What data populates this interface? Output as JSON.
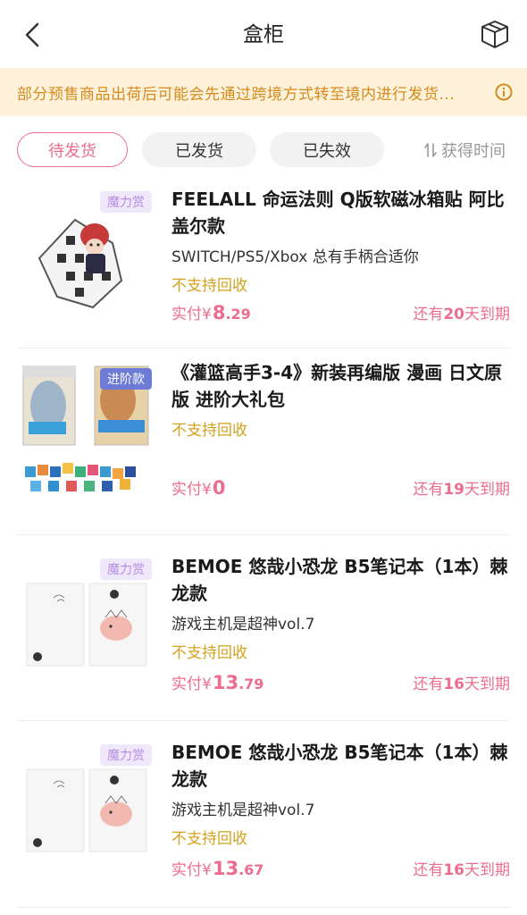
{
  "header": {
    "title": "盒柜",
    "back_icon": "chevron-left-icon",
    "box_icon": "box-icon"
  },
  "notice": {
    "text": "部分预售商品出荷后可能会先通过跨境方式转至境内进行发货...",
    "icon": "info-icon",
    "bg_color": "#fdf1d9",
    "text_color": "#d58b1e"
  },
  "tabs": [
    {
      "label": "待发货",
      "active": true
    },
    {
      "label": "已发货",
      "active": false
    },
    {
      "label": "已失效",
      "active": false
    }
  ],
  "sort": {
    "label": "获得时间",
    "icon": "sort-icon"
  },
  "accent_color": "#ec6d8d",
  "items": [
    {
      "badge": "魔力赏",
      "name": "FEELALL 命运法则 Q版软磁冰箱贴 阿比盖尔款",
      "subtitle": "SWITCH/PS5/Xbox 总有手柄合适你",
      "recycle": "不支持回收",
      "price_label": "实付¥",
      "price_int": "8",
      "price_dec": ".29",
      "expire_prefix": "还有",
      "expire_days": "20",
      "expire_suffix": "天到期"
    },
    {
      "badge": "进阶款",
      "name": "《灌篮高手3-4》新装再编版 漫画 日文原版 进阶大礼包",
      "subtitle": "",
      "recycle": "不支持回收",
      "price_label": "实付¥",
      "price_int": "0",
      "price_dec": "",
      "expire_prefix": "还有",
      "expire_days": "19",
      "expire_suffix": "天到期"
    },
    {
      "badge": "魔力赏",
      "name": "BEMOE 悠哉小恐龙 B5笔记本（1本）棘龙款",
      "subtitle": "游戏主机是超神vol.7",
      "recycle": "不支持回收",
      "price_label": "实付¥",
      "price_int": "13",
      "price_dec": ".79",
      "expire_prefix": "还有",
      "expire_days": "16",
      "expire_suffix": "天到期"
    },
    {
      "badge": "魔力赏",
      "name": "BEMOE 悠哉小恐龙 B5笔记本（1本）棘龙款",
      "subtitle": "游戏主机是超神vol.7",
      "recycle": "不支持回收",
      "price_label": "实付¥",
      "price_int": "13",
      "price_dec": ".67",
      "expire_prefix": "还有",
      "expire_days": "16",
      "expire_suffix": "天到期"
    }
  ]
}
